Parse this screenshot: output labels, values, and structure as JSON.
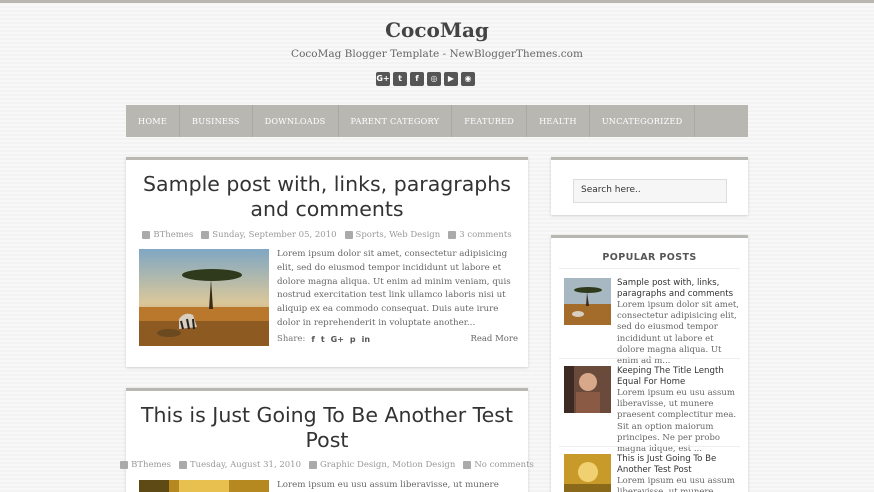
{
  "site": {
    "title": "CocoMag",
    "description": "CocoMag Blogger Template - NewBloggerThemes.com"
  },
  "social_icons": [
    "google-plus-icon",
    "twitter-icon",
    "facebook-icon",
    "instagram-icon",
    "youtube-icon",
    "rss-icon"
  ],
  "social_glyphs": [
    "G+",
    "t",
    "f",
    "◎",
    "▶",
    "◉"
  ],
  "nav": [
    "HOME",
    "BUSINESS",
    "DOWNLOADS",
    "PARENT CATEGORY",
    "FEATURED",
    "HEALTH",
    "UNCATEGORIZED"
  ],
  "posts": [
    {
      "title": "Sample post with, links, paragraphs and comments",
      "author": "BThemes",
      "date": "Sunday, September 05, 2010",
      "labels": "Sports, Web Design",
      "comments": "3 comments",
      "excerpt": "Lorem ipsum dolor sit amet, consectetur adipisicing elit, sed do eiusmod tempor incididunt ut labore et dolore magna aliqua. Ut enim ad minim veniam, quis nostrud exercitation test link ullamco laboris nisi ut aliquip ex ea commodo consequat. Duis aute irure dolor in reprehenderit in voluptate another...",
      "share_label": "Share:",
      "read_more": "Read More"
    },
    {
      "title": "This is Just Going To Be Another Test Post",
      "author": "BThemes",
      "date": "Tuesday, August 31, 2010",
      "labels": "Graphic Design, Motion Design",
      "comments": "No comments",
      "excerpt": "Lorem ipsum eu usu assum liberavisse, ut munere praesent"
    }
  ],
  "search": {
    "placeholder": "Search here.."
  },
  "popular": {
    "heading": "POPULAR POSTS",
    "items": [
      {
        "title": "Sample post with, links, paragraphs and comments",
        "excerpt": "Lorem ipsum dolor sit amet, consectetur adipisicing elit, sed do eiusmod tempor incididunt ut labore et dolore magna aliqua. Ut enim ad m..."
      },
      {
        "title": "Keeping The Title Length Equal For Home",
        "excerpt": "Lorem ipsum eu usu assum liberavisse, ut munere praesent complectitur mea. Sit an option maiorum principes. Ne per probo magna idque, est ..."
      },
      {
        "title": "This is Just Going To Be Another Test Post",
        "excerpt": "Lorem ipsum eu usu assum liberavisse, ut munere"
      }
    ]
  }
}
